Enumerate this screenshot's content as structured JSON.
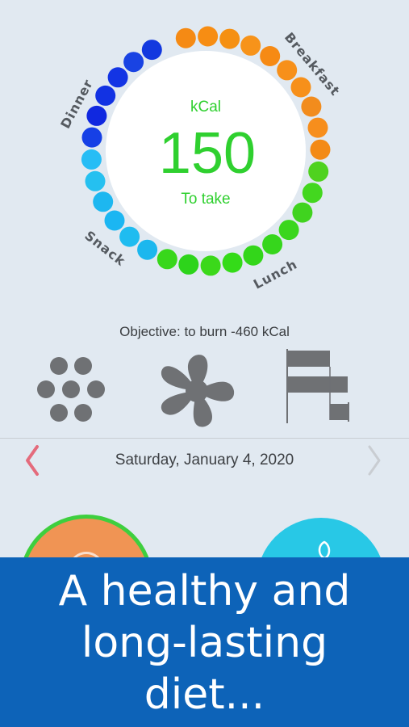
{
  "colors": {
    "background": "#e1e9f1",
    "breakfast": "#f5900f",
    "lunch": "#33dc1e",
    "snack": "#1ab2f2",
    "dinner": "#1732e0",
    "accent_green": "#2fd02f",
    "banner": "#0d63b8"
  },
  "ring": {
    "dot_colors": [
      "#f58a14",
      "#f78d13",
      "#f59012",
      "#f7931a",
      "#f68a14",
      "#f7901a",
      "#f7901a",
      "#f28c1d",
      "#f78e1c",
      "#f38a16",
      "#4fd21f",
      "#43d71f",
      "#40d31f",
      "#3ad61d",
      "#36d61c",
      "#33d61a",
      "#34db18",
      "#3bd81a",
      "#2dd41b",
      "#38d71b",
      "#1cb7ee",
      "#1fbcf0",
      "#1bb6f2",
      "#1db7f0",
      "#25c0f0",
      "#27bdf5",
      "#1640e6",
      "#1028e0",
      "#1232e3",
      "#1334e4",
      "#1943e3",
      "#1238df"
    ]
  },
  "meals": {
    "breakfast": "Breakfast",
    "lunch": "Lunch",
    "snack": "Snack",
    "dinner": "Dinner"
  },
  "center": {
    "unit": "kCal",
    "value": "150",
    "subtitle": "To take"
  },
  "objective": "Objective: to burn -460 kCal",
  "view_buttons": [
    {
      "icon": "dots-cluster-icon"
    },
    {
      "icon": "flower-chart-icon"
    },
    {
      "icon": "bar-chart-icon"
    }
  ],
  "date_nav": {
    "date": "Saturday, January 4, 2020",
    "prev_icon": "chevron-left-icon",
    "next_icon": "chevron-right-icon"
  },
  "banner": {
    "line1": "A healthy and",
    "line2": "long-lasting",
    "line3": "diet..."
  }
}
